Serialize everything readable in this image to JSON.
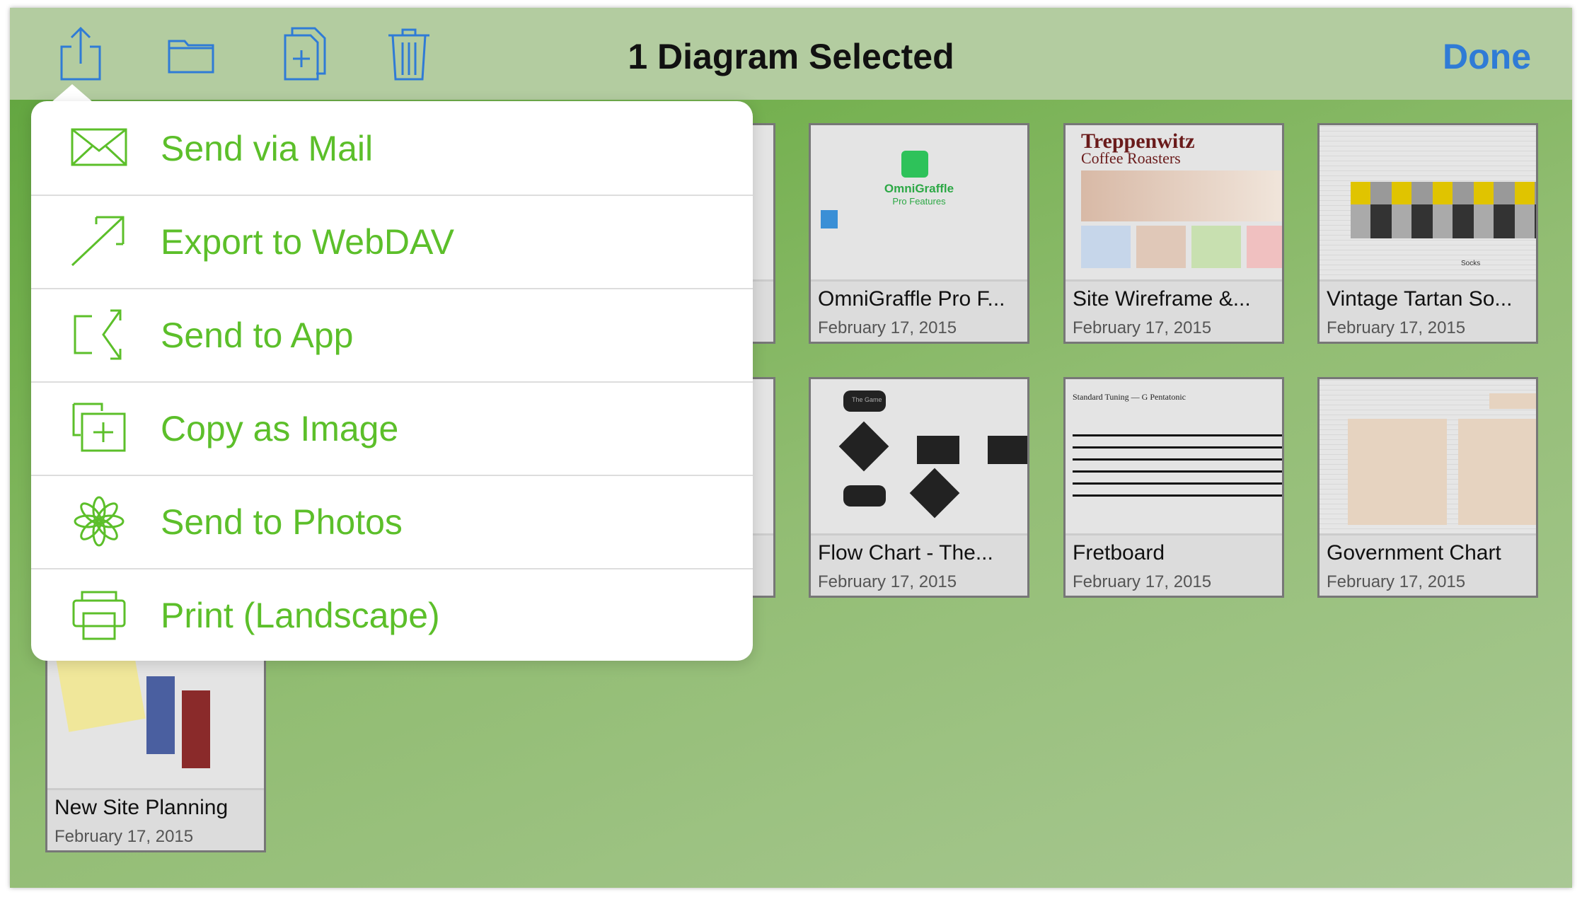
{
  "toolbar": {
    "title": "1 Diagram Selected",
    "done_label": "Done",
    "icons": [
      "share-icon",
      "folder-icon",
      "duplicate-icon",
      "trash-icon"
    ],
    "accent": "#2f7bd6"
  },
  "menu": {
    "color": "#5cbf2a",
    "items": [
      {
        "label": "Send via Mail",
        "icon": "mail-icon"
      },
      {
        "label": "Export to WebDAV",
        "icon": "export-icon"
      },
      {
        "label": "Send to App",
        "icon": "send-to-app-icon"
      },
      {
        "label": "Copy as Image",
        "icon": "copy-image-icon"
      },
      {
        "label": "Send to Photos",
        "icon": "photos-icon"
      },
      {
        "label": "Print (Landscape)",
        "icon": "print-icon"
      }
    ]
  },
  "documents": [
    {
      "name": "OmniGraffle Pro F...",
      "date": "February 17, 2015",
      "preview": [
        "OmniGraffle",
        "Pro Features"
      ]
    },
    {
      "name": "Site Wireframe &...",
      "date": "February 17, 2015",
      "preview": [
        "Treppenwitz",
        "Coffee Roasters"
      ]
    },
    {
      "name": "Vintage Tartan So...",
      "date": "February 17, 2015",
      "preview": [
        "Socks"
      ]
    },
    {
      "name": "Flow Chart - The...",
      "date": "February 17, 2015",
      "preview": [
        "The Game"
      ]
    },
    {
      "name": "Fretboard",
      "date": "February 17, 2015",
      "preview": [
        "Standard Tuning — G Pentatonic"
      ]
    },
    {
      "name": "Government Chart",
      "date": "February 17, 2015",
      "preview": []
    },
    {
      "name": "New Site Planning",
      "date": "February 17, 2015",
      "preview": []
    }
  ]
}
